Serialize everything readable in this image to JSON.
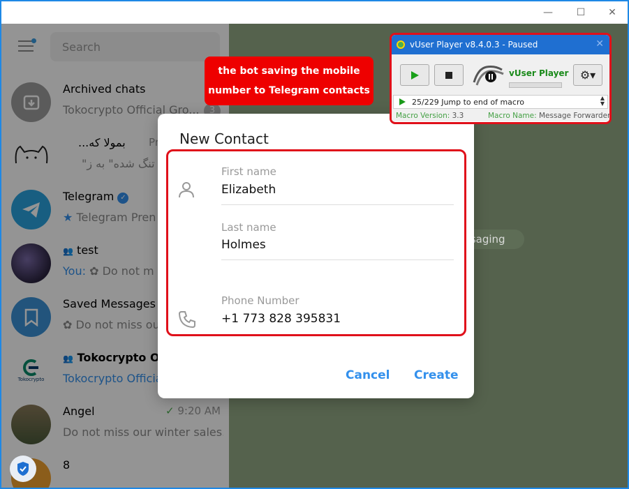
{
  "window_controls": {
    "minimize": "—",
    "maximize": "☐",
    "close": "✕"
  },
  "sidebar": {
    "search_placeholder": "Search",
    "chats": [
      {
        "name": "Archived chats",
        "message": "Tokocrypto Official Gro...",
        "badge": "3",
        "time": ""
      },
      {
        "name": "...بمولا که",
        "message": "\"ت تنگ شده\" به ز",
        "badge": "",
        "time": "Pr"
      },
      {
        "name": "Telegram",
        "message": "Telegram Pren",
        "badge": "",
        "time": ""
      },
      {
        "name": "test",
        "message_prefix": "You:",
        "message": "Do not m",
        "badge": "",
        "time": ""
      },
      {
        "name": "Saved Messages",
        "message": "Do not miss ou",
        "badge": "",
        "time": ""
      },
      {
        "name": "Tokocrypto O...",
        "message": "Tokocrypto Officia",
        "badge": "",
        "time": "",
        "avatar_label": "Tokocrypto"
      },
      {
        "name": "Angel",
        "message": "Do not miss our winter sales...",
        "badge": "",
        "time": "9:20 AM"
      },
      {
        "name": "8",
        "message": "",
        "badge": "",
        "time": ""
      }
    ]
  },
  "chat_area": {
    "pill_text": "ssaging"
  },
  "dialog": {
    "title": "New Contact",
    "first_name_label": "First name",
    "first_name_value": "Elizabeth",
    "last_name_label": "Last name",
    "last_name_value": "Holmes",
    "phone_label": "Phone Number",
    "phone_value": "+1 773 828 395831",
    "cancel_label": "Cancel",
    "create_label": "Create"
  },
  "callout": {
    "line1": "the bot saving the mobile",
    "line2": "number to Telegram contacts"
  },
  "vuser": {
    "title": "vUser Player v8.4.0.3 - Paused",
    "brand": "vUser Player",
    "status": "25/229 Jump to end of macro",
    "macro_version_label": "Macro Version:",
    "macro_version": "3.3",
    "macro_name_label": "Macro Name:",
    "macro_name": "Message Forwarder to Unsa"
  },
  "colors": {
    "accent": "#3390ec",
    "annotation_red": "#e0101a",
    "vuser_title": "#1f6fd1",
    "chat_bg": "#93aa86"
  }
}
